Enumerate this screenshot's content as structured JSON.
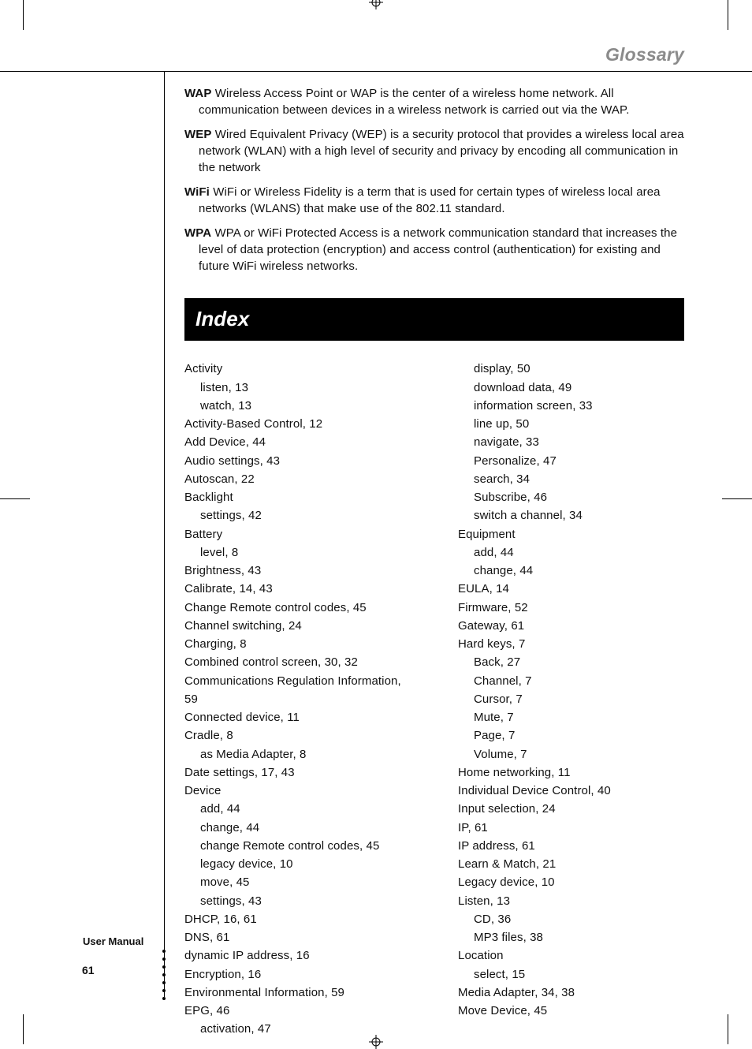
{
  "header": {
    "section_title": "Glossary"
  },
  "glossary": [
    {
      "term": "WAP",
      "body": "Wireless Access Point or WAP is the center of a wireless home network. All communication between devices in a wireless network is carried out via the WAP."
    },
    {
      "term": "WEP",
      "body": "Wired Equivalent Privacy (WEP) is a security protocol that provides a wireless local area network (WLAN) with a high level of security and privacy by encoding all communication in the network"
    },
    {
      "term": "WiFi",
      "body": "WiFi or Wireless Fidelity is a term that is used for certain types of wireless local area networks (WLANS) that make use of the 802.11 standard."
    },
    {
      "term": "WPA",
      "body": "WPA or WiFi Protected Access is a network communication standard that increases the level of data protection (encryption) and access control (authentication) for existing and future WiFi wireless networks."
    }
  ],
  "index_title": "Index",
  "index_left": [
    {
      "t": "Activity",
      "s": 0
    },
    {
      "t": "listen, 13",
      "s": 1
    },
    {
      "t": "watch, 13",
      "s": 1
    },
    {
      "t": "Activity-Based Control, 12",
      "s": 0
    },
    {
      "t": "Add Device, 44",
      "s": 0
    },
    {
      "t": "Audio settings, 43",
      "s": 0
    },
    {
      "t": "Autoscan, 22",
      "s": 0
    },
    {
      "t": "Backlight",
      "s": 0
    },
    {
      "t": "settings, 42",
      "s": 1
    },
    {
      "t": "Battery",
      "s": 0
    },
    {
      "t": "level, 8",
      "s": 1
    },
    {
      "t": "Brightness, 43",
      "s": 0
    },
    {
      "t": "Calibrate, 14, 43",
      "s": 0
    },
    {
      "t": "Change Remote control codes, 45",
      "s": 0
    },
    {
      "t": "Channel switching, 24",
      "s": 0
    },
    {
      "t": "Charging, 8",
      "s": 0
    },
    {
      "t": "Combined control screen, 30, 32",
      "s": 0
    },
    {
      "t": "Communications Regulation Information, 59",
      "s": 0
    },
    {
      "t": "Connected device, 11",
      "s": 0
    },
    {
      "t": "Cradle, 8",
      "s": 0
    },
    {
      "t": "as Media Adapter, 8",
      "s": 1
    },
    {
      "t": "Date settings, 17, 43",
      "s": 0
    },
    {
      "t": "Device",
      "s": 0
    },
    {
      "t": "add, 44",
      "s": 1
    },
    {
      "t": "change, 44",
      "s": 1
    },
    {
      "t": "change Remote control codes, 45",
      "s": 1
    },
    {
      "t": "legacy device, 10",
      "s": 1
    },
    {
      "t": "move, 45",
      "s": 1
    },
    {
      "t": "settings, 43",
      "s": 1
    },
    {
      "t": "DHCP, 16, 61",
      "s": 0
    },
    {
      "t": "DNS, 61",
      "s": 0
    },
    {
      "t": "dynamic IP address, 16",
      "s": 0
    },
    {
      "t": "Encryption, 16",
      "s": 0
    },
    {
      "t": "Environmental Information, 59",
      "s": 0
    },
    {
      "t": "EPG, 46",
      "s": 0
    },
    {
      "t": "activation, 47",
      "s": 1
    }
  ],
  "index_right": [
    {
      "t": "display, 50",
      "s": 1
    },
    {
      "t": "download data, 49",
      "s": 1
    },
    {
      "t": "information screen, 33",
      "s": 1
    },
    {
      "t": "line up, 50",
      "s": 1
    },
    {
      "t": "navigate, 33",
      "s": 1
    },
    {
      "t": "Personalize, 47",
      "s": 1
    },
    {
      "t": "search, 34",
      "s": 1
    },
    {
      "t": "Subscribe, 46",
      "s": 1
    },
    {
      "t": "switch a channel, 34",
      "s": 1
    },
    {
      "t": "Equipment",
      "s": 0
    },
    {
      "t": "add, 44",
      "s": 1
    },
    {
      "t": "change, 44",
      "s": 1
    },
    {
      "t": "EULA, 14",
      "s": 0
    },
    {
      "t": "Firmware, 52",
      "s": 0
    },
    {
      "t": "Gateway, 61",
      "s": 0
    },
    {
      "t": "Hard keys, 7",
      "s": 0
    },
    {
      "t": "Back, 27",
      "s": 1
    },
    {
      "t": "Channel, 7",
      "s": 1
    },
    {
      "t": "Cursor, 7",
      "s": 1
    },
    {
      "t": "Mute, 7",
      "s": 1
    },
    {
      "t": "Page, 7",
      "s": 1
    },
    {
      "t": "Volume, 7",
      "s": 1
    },
    {
      "t": "Home networking, 11",
      "s": 0
    },
    {
      "t": "Individual Device Control, 40",
      "s": 0
    },
    {
      "t": "Input selection, 24",
      "s": 0
    },
    {
      "t": "IP, 61",
      "s": 0
    },
    {
      "t": "IP address, 61",
      "s": 0
    },
    {
      "t": "Learn & Match, 21",
      "s": 0
    },
    {
      "t": "Legacy device, 10",
      "s": 0
    },
    {
      "t": "Listen, 13",
      "s": 0
    },
    {
      "t": "CD, 36",
      "s": 1
    },
    {
      "t": "MP3 files, 38",
      "s": 1
    },
    {
      "t": "Location",
      "s": 0
    },
    {
      "t": "select, 15",
      "s": 1
    },
    {
      "t": "Media Adapter, 34, 38",
      "s": 0
    },
    {
      "t": "Move Device, 45",
      "s": 0
    }
  ],
  "footer": {
    "label": "User Manual",
    "page_number": "61"
  }
}
